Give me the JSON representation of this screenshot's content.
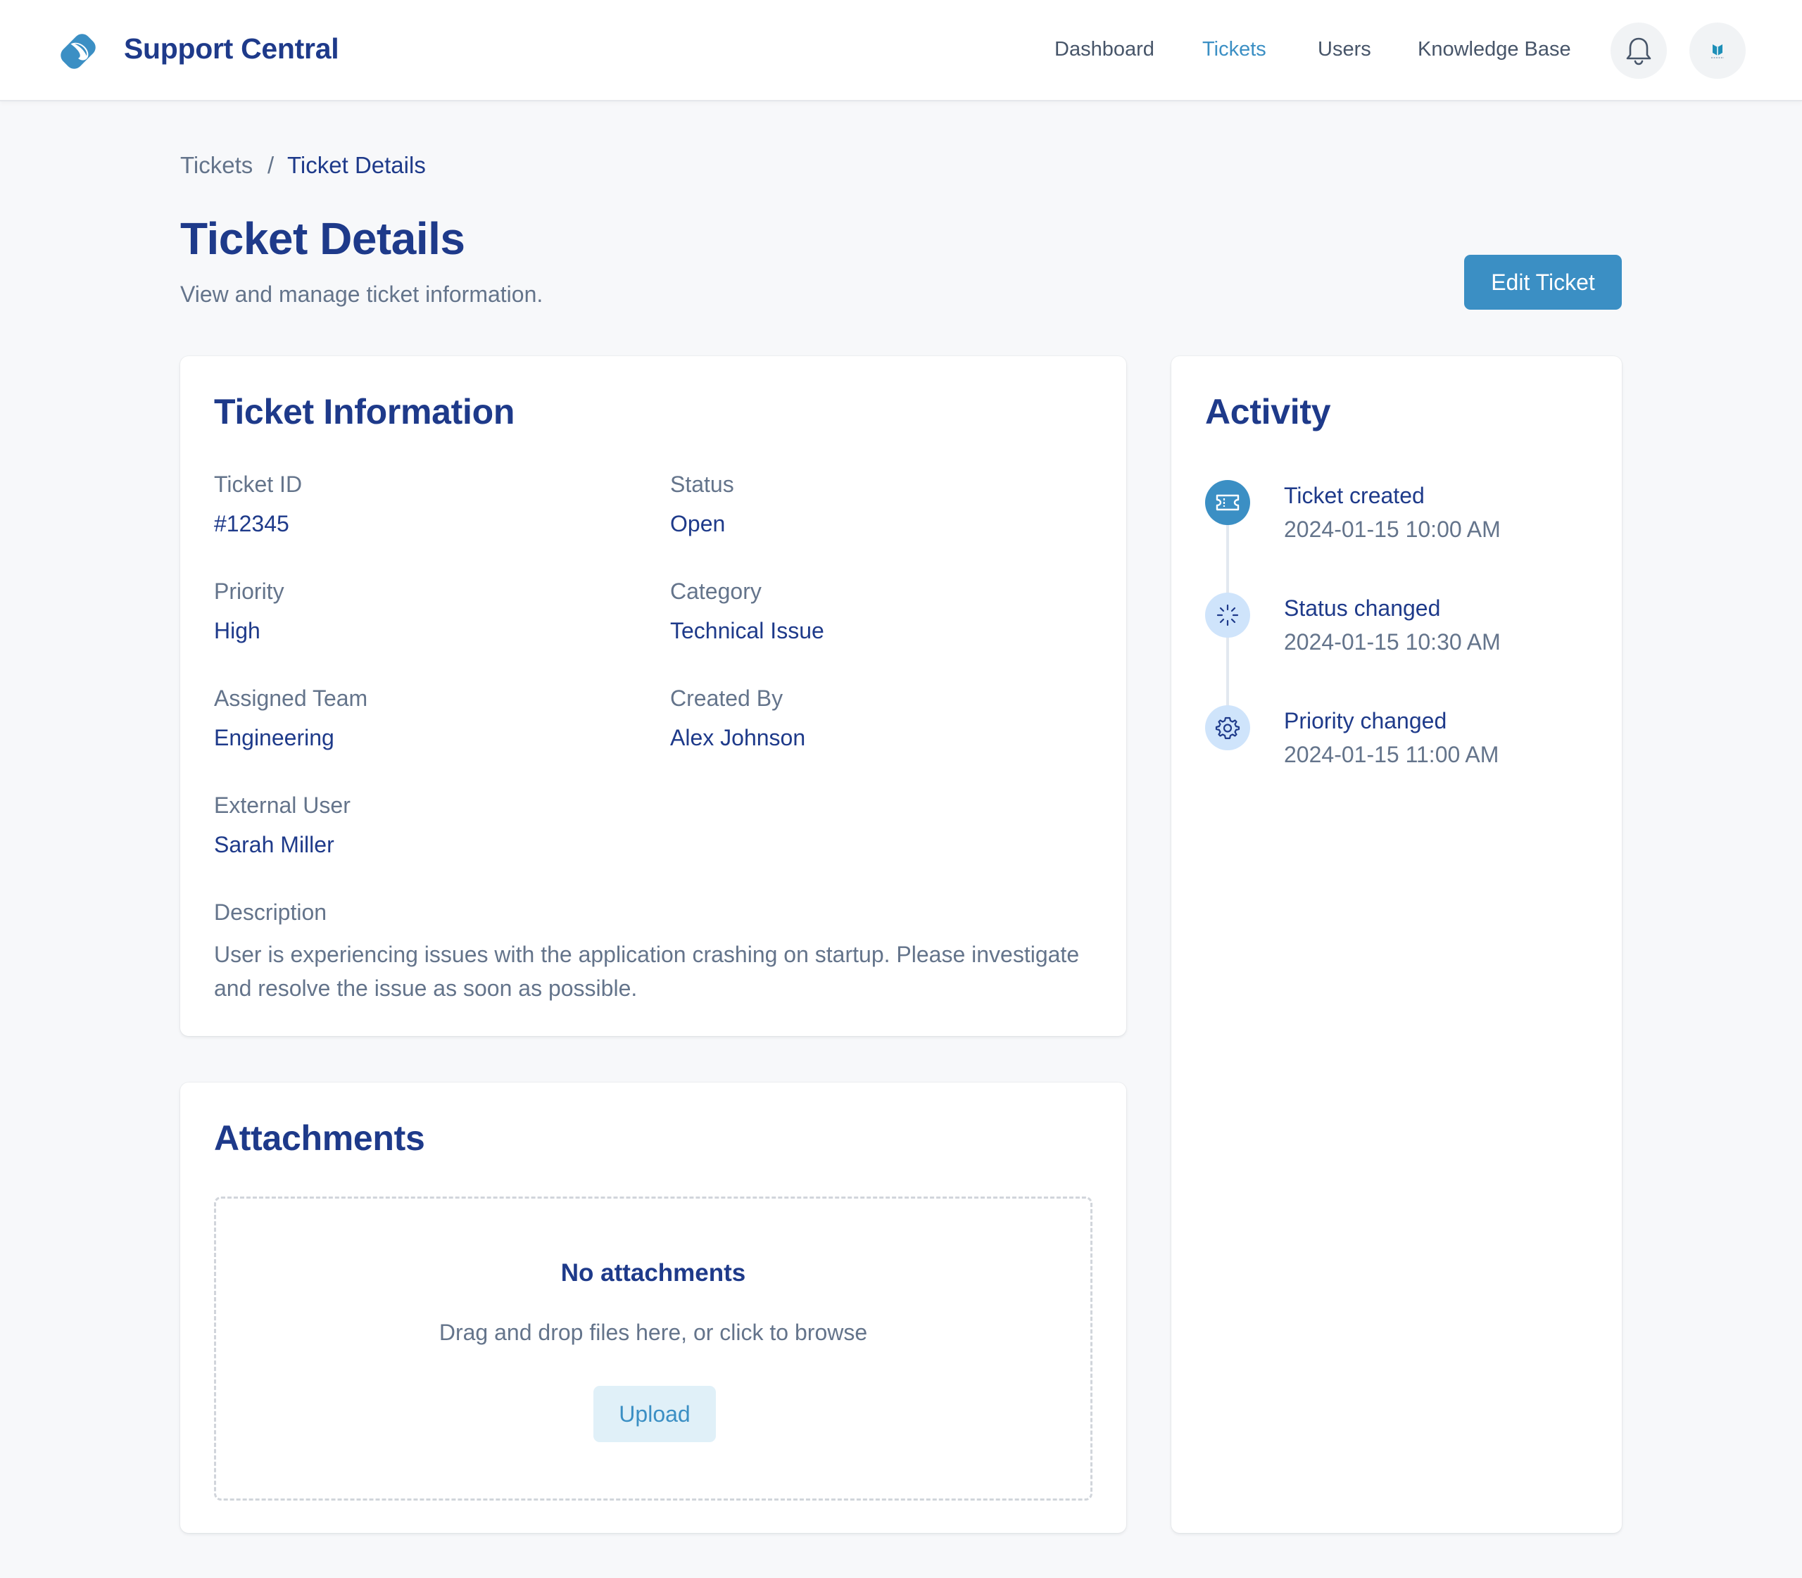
{
  "header": {
    "brand": "Support Central",
    "nav": [
      {
        "label": "Dashboard"
      },
      {
        "label": "Tickets",
        "active": true
      },
      {
        "label": "Users"
      },
      {
        "label": "Knowledge Base"
      }
    ],
    "notification_icon": "bell-icon",
    "avatar_icon": "avatar-icon"
  },
  "breadcrumb": {
    "parent": "Tickets",
    "separator": "/",
    "current": "Ticket Details"
  },
  "page": {
    "title": "Ticket Details",
    "subtitle": "View and manage ticket information.",
    "edit_button": "Edit Ticket"
  },
  "ticket_info": {
    "title": "Ticket Information",
    "fields": {
      "ticket_id": {
        "label": "Ticket ID",
        "value": "#12345"
      },
      "status": {
        "label": "Status",
        "value": "Open"
      },
      "priority": {
        "label": "Priority",
        "value": "High"
      },
      "category": {
        "label": "Category",
        "value": "Technical Issue"
      },
      "assigned_team": {
        "label": "Assigned Team",
        "value": "Engineering"
      },
      "created_by": {
        "label": "Created By",
        "value": "Alex Johnson"
      },
      "external_user": {
        "label": "External User",
        "value": "Sarah Miller"
      }
    },
    "description_label": "Description",
    "description": "User is experiencing issues with the application crashing on startup. Please investigate and resolve the issue as soon as possible."
  },
  "attachments": {
    "title": "Attachments",
    "empty_title": "No attachments",
    "empty_hint": "Drag and drop files here, or click to browse",
    "upload_button": "Upload"
  },
  "activity": {
    "title": "Activity",
    "items": [
      {
        "title": "Ticket created",
        "time": "2024-01-15 10:00 AM",
        "icon": "ticket-icon"
      },
      {
        "title": "Status changed",
        "time": "2024-01-15 10:30 AM",
        "icon": "loader-icon"
      },
      {
        "title": "Priority changed",
        "time": "2024-01-15 11:00 AM",
        "icon": "gear-icon"
      }
    ]
  },
  "colors": {
    "primary": "#3b8fc4",
    "heading": "#1e3a8a",
    "muted": "#64748b",
    "background": "#f7f8fa"
  }
}
